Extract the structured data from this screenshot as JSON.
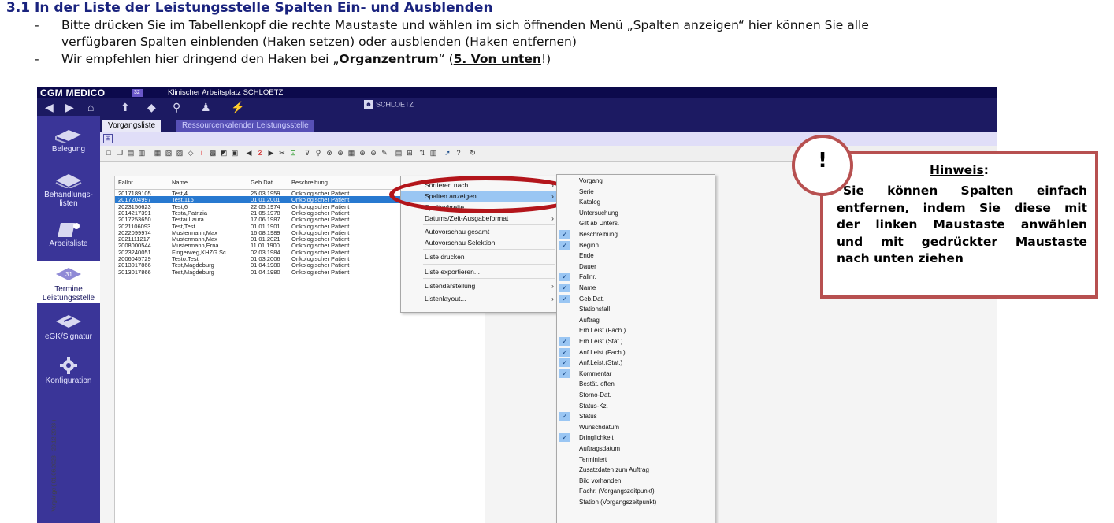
{
  "doc": {
    "heading": "3.1 In der Liste der Leistungsstelle Spalten Ein- und Ausblenden",
    "bullets": [
      {
        "dash": "-",
        "line1": "Bitte drücken Sie im Tabellenkopf die rechte Maustaste und wählen im sich öffnenden Menü „Spalten anzeigen“ hier können Sie alle",
        "line2": "verfügbaren Spalten einblenden (Haken setzen) oder ausblenden (Haken entfernen)"
      },
      {
        "dash": "-",
        "pre": "Wir empfehlen hier dringend den Haken bei „",
        "bold": "Organzentrum",
        "mid": "“ (",
        "bold_u": "5. Von unten",
        "post": "!)"
      }
    ]
  },
  "app": {
    "name": "CGM MEDICO",
    "badge": "32",
    "context_title": "Klinischer Arbeitsplatz SCHLOETZ",
    "user": "SCHLOETZ",
    "sidebar": [
      {
        "label": "Belegung"
      },
      {
        "label": "Behandlungs-listen"
      },
      {
        "label": "Arbeitsliste"
      },
      {
        "label": "Termine Leistungsstelle"
      },
      {
        "label": "eGK/Signatur"
      },
      {
        "label": "Konfiguration"
      }
    ],
    "tabs": [
      "Vorgangsliste",
      "Ressourcenkalender Leistungsstelle"
    ],
    "vertical_label": "Vorgänge ( 01.06.2023 - 20.12.2023 )",
    "grid": {
      "headers": [
        "Fallnr.",
        "Name",
        "Geb.Dat.",
        "Beschreibung"
      ],
      "rows": [
        [
          "2017189105",
          "Test,4",
          "25.03.1959",
          "Onkologischer Patient"
        ],
        [
          "2017204997",
          "Test,116",
          "01.01.2001",
          "Onkologischer Patient"
        ],
        [
          "2023156623",
          "Test,6",
          "22.05.1974",
          "Onkologischer Patient"
        ],
        [
          "2014217391",
          "Testa,Patrizia",
          "21.05.1978",
          "Onkologischer Patient"
        ],
        [
          "2017253650",
          "Testai,Laura",
          "17.06.1987",
          "Onkologischer Patient"
        ],
        [
          "2021106093",
          "Test,Test",
          "01.01.1901",
          "Onkologischer Patient"
        ],
        [
          "2022099974",
          "Mustermann,Max",
          "16.08.1989",
          "Onkologischer Patient"
        ],
        [
          "2021111217",
          "Mustermann,Max",
          "01.01.2021",
          "Onkologischer Patient"
        ],
        [
          "2008000544",
          "Mustermann,Erna",
          "11.01.1900",
          "Onkologischer Patient"
        ],
        [
          "2023240051",
          "Fingerweg,KHZG Sc...",
          "02.03.1984",
          "Onkologischer Patient"
        ],
        [
          "2006045729",
          "Testo,Testi",
          "01.03.2006",
          "Onkologischer Patient"
        ],
        [
          "2013017866",
          "Test,Magdeburg",
          "01.04.1980",
          "Onkologischer Patient"
        ],
        [
          "2013017866",
          "Test,Magdeburg",
          "01.04.1980",
          "Onkologischer Patient"
        ]
      ]
    },
    "context_menu": [
      {
        "label": "Sortieren nach",
        "arrow": "›"
      },
      {
        "label": "Spalten anzeigen",
        "arrow": "›"
      },
      {
        "label": "Spaltenbreite",
        "arrow": ""
      },
      {
        "label": "Datums/Zeit-Ausgabeformat",
        "arrow": "›"
      },
      {
        "label": "Autovorschau gesamt",
        "arrow": ""
      },
      {
        "label": "Autovorschau Selektion",
        "arrow": ""
      },
      {
        "label": "Liste drucken",
        "arrow": ""
      },
      {
        "label": "Liste exportieren...",
        "arrow": ""
      },
      {
        "label": "Listendarstellung",
        "arrow": "›"
      },
      {
        "label": "Listenlayout...",
        "arrow": "›"
      }
    ],
    "submenu": [
      {
        "label": "Vorgang",
        "checked": false
      },
      {
        "label": "Serie",
        "checked": false
      },
      {
        "label": "Katalog",
        "checked": false
      },
      {
        "label": "Untersuchung",
        "checked": false
      },
      {
        "label": "Gilt ab Unters.",
        "checked": false
      },
      {
        "label": "Beschreibung",
        "checked": true
      },
      {
        "label": "Beginn",
        "checked": true
      },
      {
        "label": "Ende",
        "checked": false
      },
      {
        "label": "Dauer",
        "checked": false
      },
      {
        "label": "Fallnr.",
        "checked": true
      },
      {
        "label": "Name",
        "checked": true
      },
      {
        "label": "Geb.Dat.",
        "checked": true
      },
      {
        "label": "Stationsfall",
        "checked": false
      },
      {
        "label": "Auftrag",
        "checked": false
      },
      {
        "label": "Erb.Leist.(Fach.)",
        "checked": false
      },
      {
        "label": "Erb.Leist.(Stat.)",
        "checked": true
      },
      {
        "label": "Anf.Leist.(Fach.)",
        "checked": true
      },
      {
        "label": "Anf.Leist.(Stat.)",
        "checked": true
      },
      {
        "label": "Kommentar",
        "checked": true
      },
      {
        "label": "Bestät. offen",
        "checked": false
      },
      {
        "label": "Storno-Dat.",
        "checked": false
      },
      {
        "label": "Status-Kz.",
        "checked": false
      },
      {
        "label": "Status",
        "checked": true
      },
      {
        "label": "Wunschdatum",
        "checked": false
      },
      {
        "label": "Dringlichkeit",
        "checked": true
      },
      {
        "label": "Auftragsdatum",
        "checked": false
      },
      {
        "label": "Terminiert",
        "checked": false
      },
      {
        "label": "Zusatzdaten zum Auftrag",
        "checked": false
      },
      {
        "label": "Bild vorhanden",
        "checked": false
      },
      {
        "label": "Fachr. (Vorgangszeitpunkt)",
        "checked": false
      },
      {
        "label": "Station (Vorgangszeitpunkt)",
        "checked": false
      }
    ],
    "check_glyph": "✓"
  },
  "note": {
    "bang": "!",
    "title": "Hinweis",
    "title_suffix": ":",
    "lines": [
      "Sie können Spalten einfach",
      "entfernen, indem Sie diese mit",
      "der linken Maustaste anwählen",
      "und mit gedrückter Maustaste",
      "nach unten ziehen"
    ]
  },
  "colors": {
    "heading": "#1a237e",
    "app_dark": "#1c1a62",
    "sidebar": "#3a3598",
    "selected_row": "#2879d0",
    "menu_highlight": "#9ac6f3",
    "annotation_red": "#b3151b",
    "note_border": "#b75050"
  },
  "icons": [
    "back-icon",
    "forward-icon",
    "home-icon",
    "bed-icon",
    "list-icon",
    "worklist-icon",
    "calendar-icon",
    "card-icon",
    "gear-icon",
    "user-icon",
    "checkmark-icon"
  ]
}
